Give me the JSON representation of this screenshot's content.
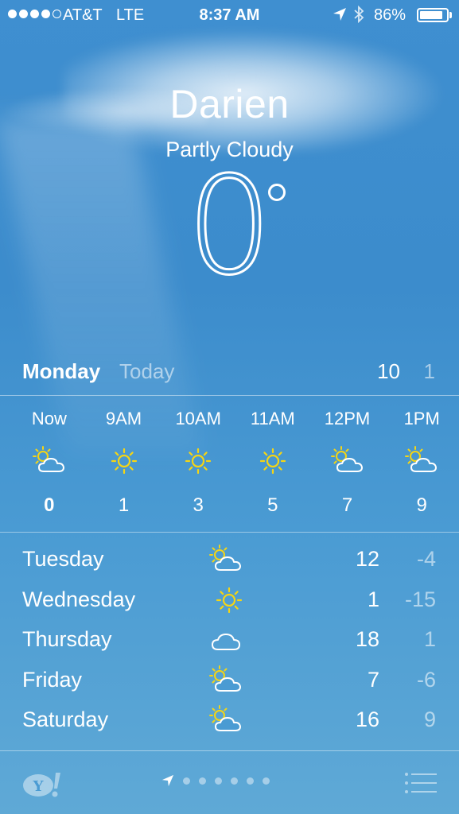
{
  "status_bar": {
    "signal_dots_filled": 4,
    "signal_dots_total": 5,
    "carrier": "AT&T",
    "network": "LTE",
    "time": "8:37 AM",
    "location_icon": "location-arrow-icon",
    "bluetooth_icon": "bluetooth-icon",
    "battery_percent": "86%",
    "battery_level": 0.86
  },
  "location": {
    "city": "Darien",
    "condition": "Partly Cloudy",
    "temperature": "0"
  },
  "today": {
    "day": "Monday",
    "label": "Today",
    "high": "10",
    "low": "1"
  },
  "hourly": [
    {
      "time": "Now",
      "icon": "partly-cloudy-icon",
      "temp": "0"
    },
    {
      "time": "9AM",
      "icon": "sunny-icon",
      "temp": "1"
    },
    {
      "time": "10AM",
      "icon": "sunny-icon",
      "temp": "3"
    },
    {
      "time": "11AM",
      "icon": "sunny-icon",
      "temp": "5"
    },
    {
      "time": "12PM",
      "icon": "partly-cloudy-icon",
      "temp": "7"
    },
    {
      "time": "1PM",
      "icon": "partly-cloudy-icon",
      "temp": "9"
    }
  ],
  "daily": [
    {
      "day": "Tuesday",
      "icon": "partly-cloudy-icon",
      "high": "12",
      "low": "-4"
    },
    {
      "day": "Wednesday",
      "icon": "sunny-icon",
      "high": "1",
      "low": "-15"
    },
    {
      "day": "Thursday",
      "icon": "cloudy-icon",
      "high": "18",
      "low": "1"
    },
    {
      "day": "Friday",
      "icon": "partly-cloudy-icon",
      "high": "7",
      "low": "-6"
    },
    {
      "day": "Saturday",
      "icon": "partly-cloudy-icon",
      "high": "16",
      "low": "9"
    }
  ],
  "bottom_bar": {
    "logo": "yahoo-logo",
    "page_count": 6,
    "menu_icon": "list-icon"
  },
  "colors": {
    "sun": "#f5d514",
    "text": "#ffffff",
    "muted": "rgba(255,255,255,0.55)"
  }
}
